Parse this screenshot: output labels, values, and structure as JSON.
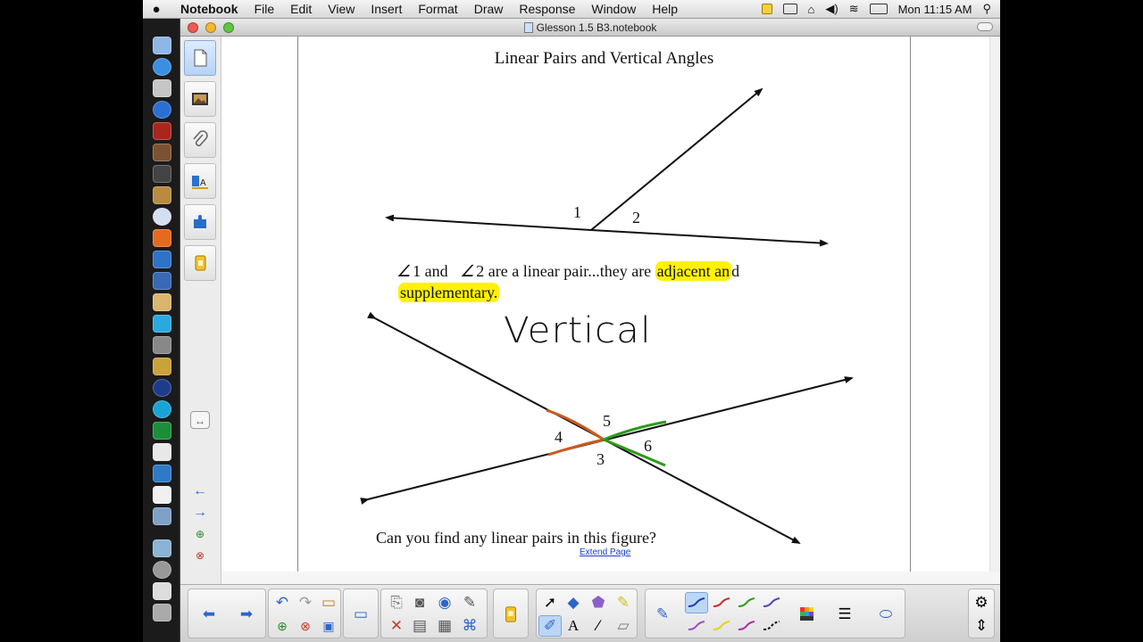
{
  "menubar": {
    "app_name": "Notebook",
    "menus": [
      "File",
      "Edit",
      "View",
      "Insert",
      "Format",
      "Draw",
      "Response",
      "Window",
      "Help"
    ],
    "clock": "Mon 11:15 AM"
  },
  "window": {
    "title": "Glesson 1.5 B3.notebook"
  },
  "page": {
    "title": "Linear Pairs and Vertical Angles",
    "angle_labels_top": [
      "1",
      "2"
    ],
    "statement": {
      "angle_symbol": "∠",
      "part1": "1 and",
      "part2": "2 are a linear pair...they are",
      "highlight1": "adjacent an",
      "part3": "d",
      "highlight2": "supplementary."
    },
    "handwriting": "Vertical",
    "angle_labels_bottom": [
      "5",
      "4",
      "6",
      "3"
    ],
    "question": "Can you find any linear pairs in this figure?",
    "extend_link": "Extend Page"
  },
  "colors": {
    "highlight": "#fff200",
    "arc_orange": "#cc5a1e",
    "arc_green": "#2e9a1c",
    "selection": "#bcd6f5"
  },
  "sidepanel": {
    "tabs": [
      "page-sorter-icon",
      "gallery-icon",
      "attachments-icon",
      "properties-icon",
      "addons-icon",
      "response-icon"
    ]
  }
}
